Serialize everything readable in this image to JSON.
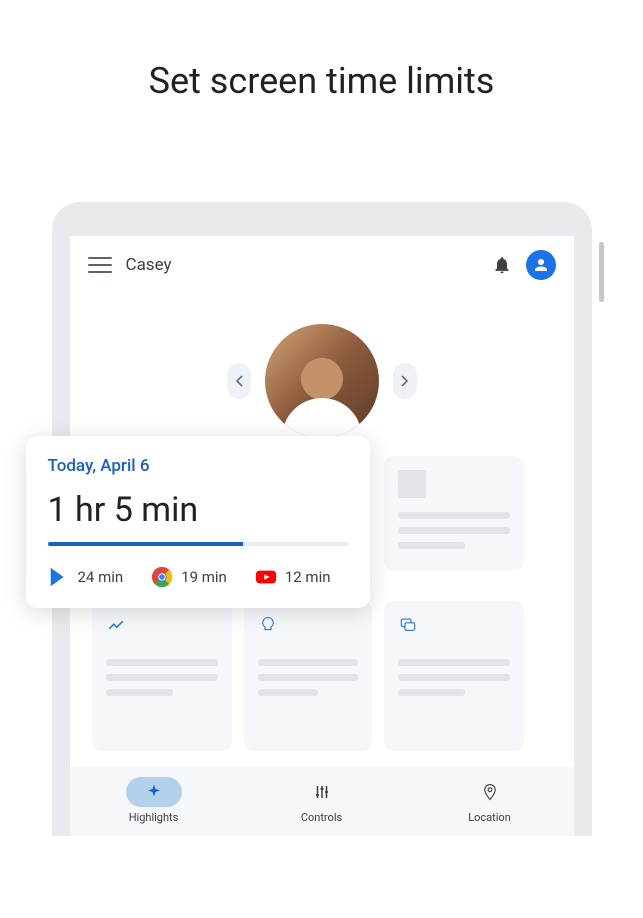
{
  "page_heading": "Set screen time limits",
  "header": {
    "child_name": "Casey"
  },
  "screentime": {
    "date_label": "Today, April 6",
    "total_time": "1 hr 5 min",
    "progress_percent": 65,
    "apps": [
      {
        "icon": "play-store",
        "time": "24 min"
      },
      {
        "icon": "chrome",
        "time": "19 min"
      },
      {
        "icon": "youtube",
        "time": "12 min"
      }
    ]
  },
  "bottom_nav": {
    "items": [
      {
        "label": "Highlights",
        "icon": "sparkle",
        "active": true
      },
      {
        "label": "Controls",
        "icon": "sliders",
        "active": false
      },
      {
        "label": "Location",
        "icon": "pin",
        "active": false
      }
    ]
  }
}
